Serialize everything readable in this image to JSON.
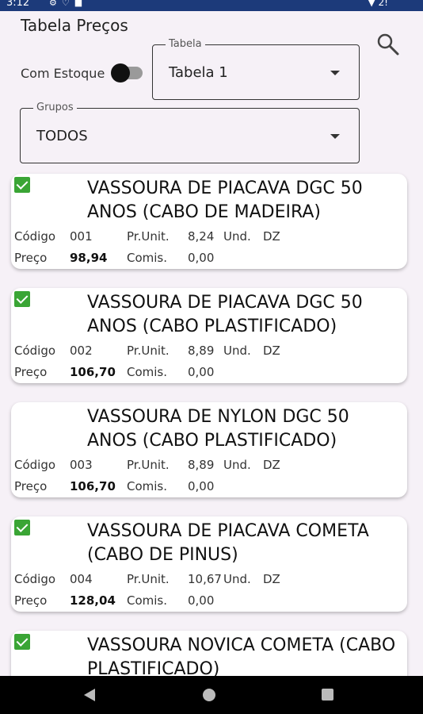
{
  "statusbar": {
    "time": "3:12",
    "right": "▼ 2!"
  },
  "header": {
    "title": "Tabela Preços"
  },
  "filters": {
    "stock_label": "Com Estoque",
    "table_legend": "Tabela",
    "table_value": "Tabela 1",
    "groups_legend": "Grupos",
    "groups_value": "TODOS"
  },
  "labels": {
    "code": "Código",
    "unit_price": "Pr.Unit.",
    "unit": "Und.",
    "price": "Preço",
    "commission": "Comis."
  },
  "products": [
    {
      "checked": true,
      "name": "VASSOURA DE PIACAVA DGC 50 ANOS (CABO DE MADEIRA)",
      "code": "001",
      "unit_price": "8,24",
      "unit": "DZ",
      "price": "98,94",
      "commission": "0,00"
    },
    {
      "checked": true,
      "name": "VASSOURA DE PIACAVA DGC 50 ANOS (CABO PLASTIFICADO)",
      "code": "002",
      "unit_price": "8,89",
      "unit": "DZ",
      "price": "106,70",
      "commission": "0,00"
    },
    {
      "checked": false,
      "name": "VASSOURA DE NYLON DGC 50 ANOS (CABO PLASTIFICADO)",
      "code": "003",
      "unit_price": "8,89",
      "unit": "DZ",
      "price": "106,70",
      "commission": "0,00"
    },
    {
      "checked": true,
      "name": "VASSOURA DE PIACAVA COMETA (CABO DE PINUS)",
      "code": "004",
      "unit_price": "10,67",
      "unit": "DZ",
      "price": "128,04",
      "commission": "0,00"
    },
    {
      "checked": true,
      "name": "VASSOURA NOVICA COMETA (CABO PLASTIFICADO)",
      "code": "",
      "unit_price": "",
      "unit": "",
      "price": "",
      "commission": ""
    }
  ]
}
